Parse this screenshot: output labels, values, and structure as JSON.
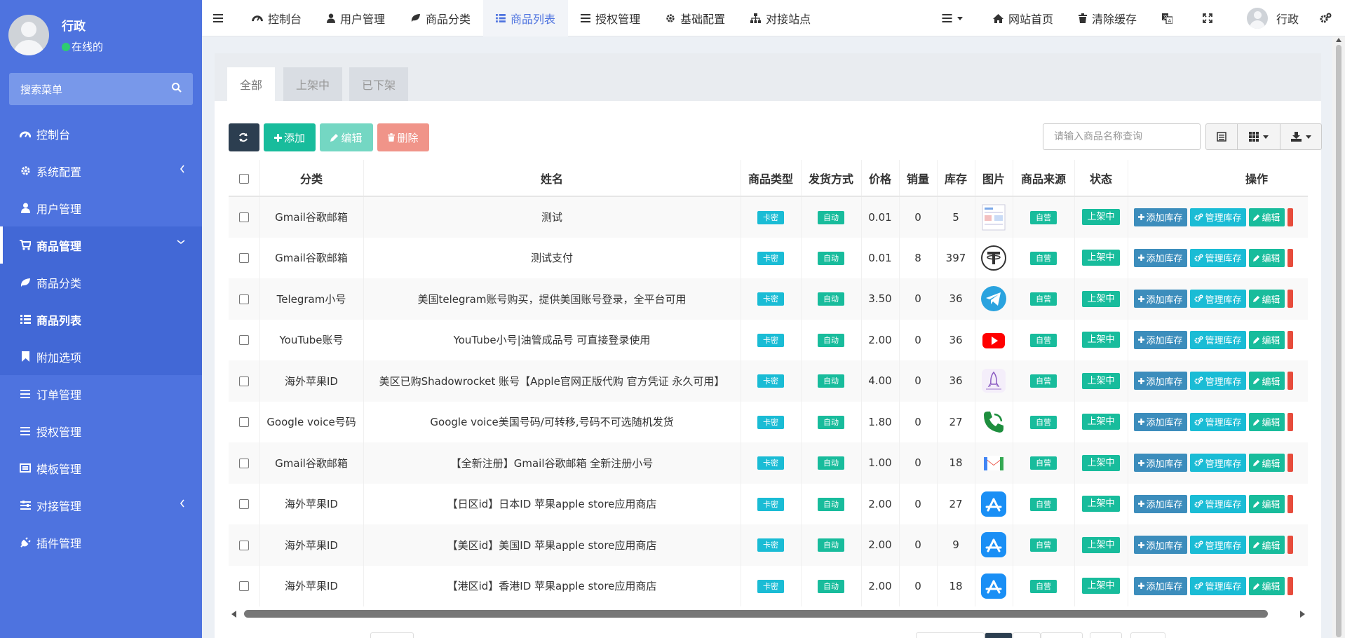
{
  "sidebar": {
    "user_name": "行政",
    "user_status": "在线的",
    "search_placeholder": "搜索菜单",
    "items": [
      {
        "label": "控制台",
        "icon": "dashboard-icon"
      },
      {
        "label": "系统配置",
        "icon": "gear-icon"
      },
      {
        "label": "用户管理",
        "icon": "user-icon"
      },
      {
        "label": "商品管理",
        "icon": "cart-icon"
      },
      {
        "label": "商品分类",
        "icon": "leaf-icon"
      },
      {
        "label": "商品列表",
        "icon": "list-icon"
      },
      {
        "label": "附加选项",
        "icon": "bookmark-icon"
      },
      {
        "label": "订单管理",
        "icon": "bars-icon"
      },
      {
        "label": "授权管理",
        "icon": "bars-icon"
      },
      {
        "label": "模板管理",
        "icon": "newspaper-icon"
      },
      {
        "label": "对接管理",
        "icon": "sliders-icon"
      },
      {
        "label": "插件管理",
        "icon": "plug-icon"
      }
    ]
  },
  "topnav": {
    "items": [
      "控制台",
      "用户管理",
      "商品分类",
      "商品列表",
      "授权管理",
      "基础配置",
      "对接站点"
    ],
    "site_home": "网站首页",
    "clear_cache": "清除缓存",
    "user_name": "行政"
  },
  "tabs": [
    "全部",
    "上架中",
    "已下架"
  ],
  "toolbar": {
    "add": "添加",
    "edit": "编辑",
    "delete": "删除",
    "search_placeholder": "请输入商品名称查询"
  },
  "table": {
    "headers": [
      "分类",
      "姓名",
      "商品类型",
      "发货方式",
      "价格",
      "销量",
      "库存",
      "图片",
      "商品来源",
      "状态",
      "操作"
    ],
    "badges": {
      "type": "卡密",
      "delivery": "自动",
      "source": "自营",
      "status": "上架中"
    },
    "ops": {
      "add_stock": "添加库存",
      "manage_stock": "管理库存",
      "edit": "编辑"
    },
    "rows": [
      {
        "category": "Gmail谷歌邮箱",
        "name": "测试",
        "price": "0.01",
        "sales": "0",
        "stock": "5",
        "img": "screenshot"
      },
      {
        "category": "Gmail谷歌邮箱",
        "name": "测试支付",
        "price": "0.01",
        "sales": "8",
        "stock": "397",
        "img": "tether"
      },
      {
        "category": "Telegram小号",
        "name": "美国telegram账号购买，提供美国账号登录，全平台可用",
        "price": "3.50",
        "sales": "0",
        "stock": "36",
        "img": "telegram"
      },
      {
        "category": "YouTube账号",
        "name": "YouTube小号|油管成品号 可直接登录使用",
        "price": "2.00",
        "sales": "0",
        "stock": "36",
        "img": "youtube"
      },
      {
        "category": "海外苹果ID",
        "name": "美区已购Shadowrocket 账号【Apple官网正版代购 官方凭证 永久可用】",
        "price": "4.00",
        "sales": "0",
        "stock": "36",
        "img": "rocket"
      },
      {
        "category": "Google voice号码",
        "name": "Google voice美国号码/可转移,号码不可选随机发货",
        "price": "1.80",
        "sales": "0",
        "stock": "27",
        "img": "phone"
      },
      {
        "category": "Gmail谷歌邮箱",
        "name": "【全新注册】Gmail谷歌邮箱 全新注册小号",
        "price": "1.00",
        "sales": "0",
        "stock": "18",
        "img": "gmail"
      },
      {
        "category": "海外苹果ID",
        "name": "【日区id】日本ID 苹果apple store应用商店",
        "price": "2.00",
        "sales": "0",
        "stock": "27",
        "img": "appstore"
      },
      {
        "category": "海外苹果ID",
        "name": "【美区id】美国ID 苹果apple store应用商店",
        "price": "2.00",
        "sales": "0",
        "stock": "9",
        "img": "appstore"
      },
      {
        "category": "海外苹果ID",
        "name": "【港区id】香港ID 苹果apple store应用商店",
        "price": "2.00",
        "sales": "0",
        "stock": "18",
        "img": "appstore"
      }
    ]
  }
}
